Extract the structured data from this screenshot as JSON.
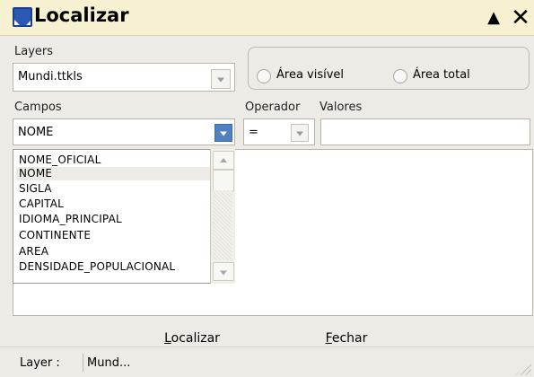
{
  "window": {
    "title": "Localizar"
  },
  "layers": {
    "label": "Layers",
    "value": "Mundi.ttkls"
  },
  "area": {
    "visible_label": "Área visível",
    "total_label": "Área total"
  },
  "campos": {
    "label": "Campos",
    "value": "NOME",
    "items": [
      {
        "label": "NOME_OFICIAL"
      },
      {
        "label": "NOME"
      },
      {
        "label": "SIGLA"
      },
      {
        "label": "CAPITAL"
      },
      {
        "label": "IDIOMA_PRINCIPAL"
      },
      {
        "label": "CONTINENTE"
      },
      {
        "label": "AREA"
      },
      {
        "label": "DENSIDADE_POPULACIONAL"
      }
    ]
  },
  "operador": {
    "label": "Operador",
    "value": "="
  },
  "valores": {
    "label": "Valores",
    "value": ""
  },
  "buttons": {
    "localizar_first": "L",
    "localizar_rest": "ocalizar",
    "fechar_first": "F",
    "fechar_rest": "echar"
  },
  "status": {
    "layer_label": "Layer :",
    "layer_value": "Mund..."
  },
  "colors": {
    "titlebar": "#f6f1d1",
    "accent": "#4f80bf"
  }
}
